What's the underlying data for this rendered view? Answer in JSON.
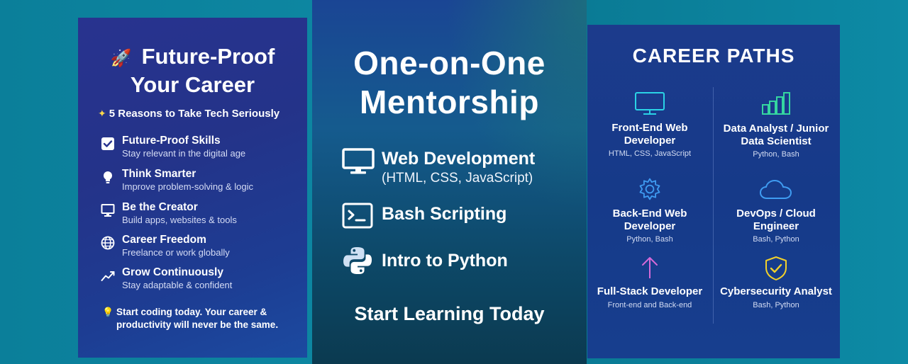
{
  "left_panel": {
    "title_line1": "Future-Proof",
    "title_line2": "Your Career",
    "title_icon": "rocket-icon",
    "subtitle": "5 Reasons to Take Tech Seriously",
    "subtitle_icon": "sparkles-icon",
    "reasons": [
      {
        "title": "Future-Proof Skills",
        "desc": "Stay relevant in the digital age",
        "icon": "checkbox-icon"
      },
      {
        "title": "Think Smarter",
        "desc": "Improve problem-solving & logic",
        "icon": "lightbulb-icon"
      },
      {
        "title": "Be the Creator",
        "desc": "Build apps, websites & tools",
        "icon": "monitor-icon"
      },
      {
        "title": "Career Freedom",
        "desc": "Freelance or work globally",
        "icon": "globe-icon"
      },
      {
        "title": "Grow Continuously",
        "desc": "Stay adaptable & confident",
        "icon": "trend-up-icon"
      }
    ],
    "footer": "Start coding today. Your career & productivity will never be the same.",
    "footer_icon": "lightbulb-icon"
  },
  "middle_panel": {
    "title_line1": "One-on-One",
    "title_line2": "Mentorship",
    "courses": [
      {
        "title": "Web Development",
        "desc": "(HTML, CSS, JavaScript)",
        "icon": "monitor-icon"
      },
      {
        "title": "Bash Scripting",
        "desc": "",
        "icon": "terminal-icon"
      },
      {
        "title": "Intro to Python",
        "desc": "",
        "icon": "python-icon"
      }
    ],
    "cta": "Start Learning Today"
  },
  "right_panel": {
    "title": "CAREER PATHS",
    "careers": [
      {
        "title": "Front-End Web Developer",
        "desc": "HTML, CSS, JavaScript",
        "icon": "monitor-icon"
      },
      {
        "title": "Data Analyst / Junior Data Scientist",
        "desc": "Python, Bash",
        "icon": "bar-chart-icon"
      },
      {
        "title": "Back-End Web Developer",
        "desc": "Python, Bash",
        "icon": "gear-icon"
      },
      {
        "title": "DevOps / Cloud Engineer",
        "desc": "Bash, Python",
        "icon": "cloud-icon"
      },
      {
        "title": "Full-Stack Developer",
        "desc": "Front-end and Back-end",
        "icon": "arrow-up-icon"
      },
      {
        "title": "Cybersecurity Analyst",
        "desc": "Bash, Python",
        "icon": "shield-check-icon"
      }
    ]
  },
  "colors": {
    "accent_cyan": "#2ad3e6",
    "accent_green": "#35d6a0",
    "accent_pink": "#d56ad8",
    "accent_yellow": "#f2d12b",
    "accent_blue": "#3f9cf2",
    "python_blue": "#cfe0f3"
  }
}
